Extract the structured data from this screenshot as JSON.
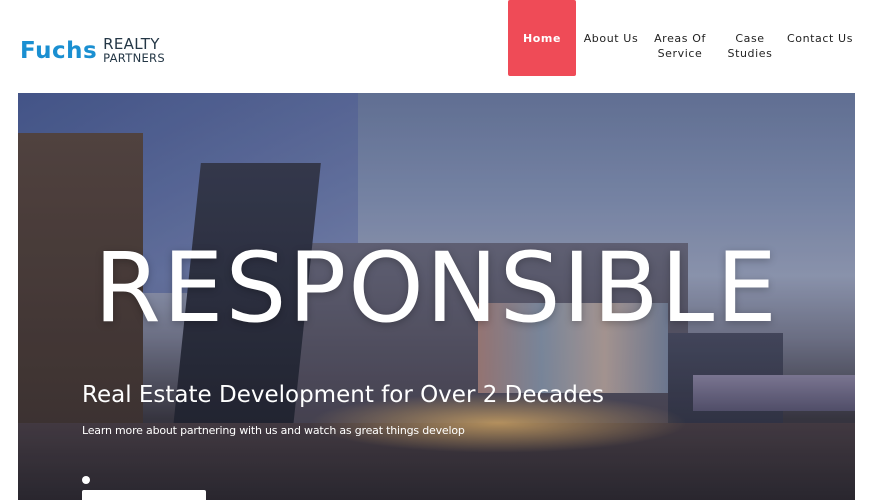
{
  "logo": {
    "word1": "Fuchs",
    "word2": "REALTY",
    "word3": "PARTNERS"
  },
  "nav": {
    "items": [
      {
        "label": "Home",
        "active": true
      },
      {
        "label": "About Us",
        "active": false
      },
      {
        "label": "Areas Of\nService",
        "active": false
      },
      {
        "label": "Case\nStudies",
        "active": false
      },
      {
        "label": "Contact Us",
        "active": false
      }
    ]
  },
  "hero": {
    "title": "RESPONSIBLE",
    "subtitle": "Real Estate Development for Over 2 Decades",
    "description": "Learn more about partnering with us and watch as great things develop"
  },
  "colors": {
    "accent": "#ef4b57",
    "logo_blue": "#1a8fd1",
    "logo_dark": "#243746"
  }
}
